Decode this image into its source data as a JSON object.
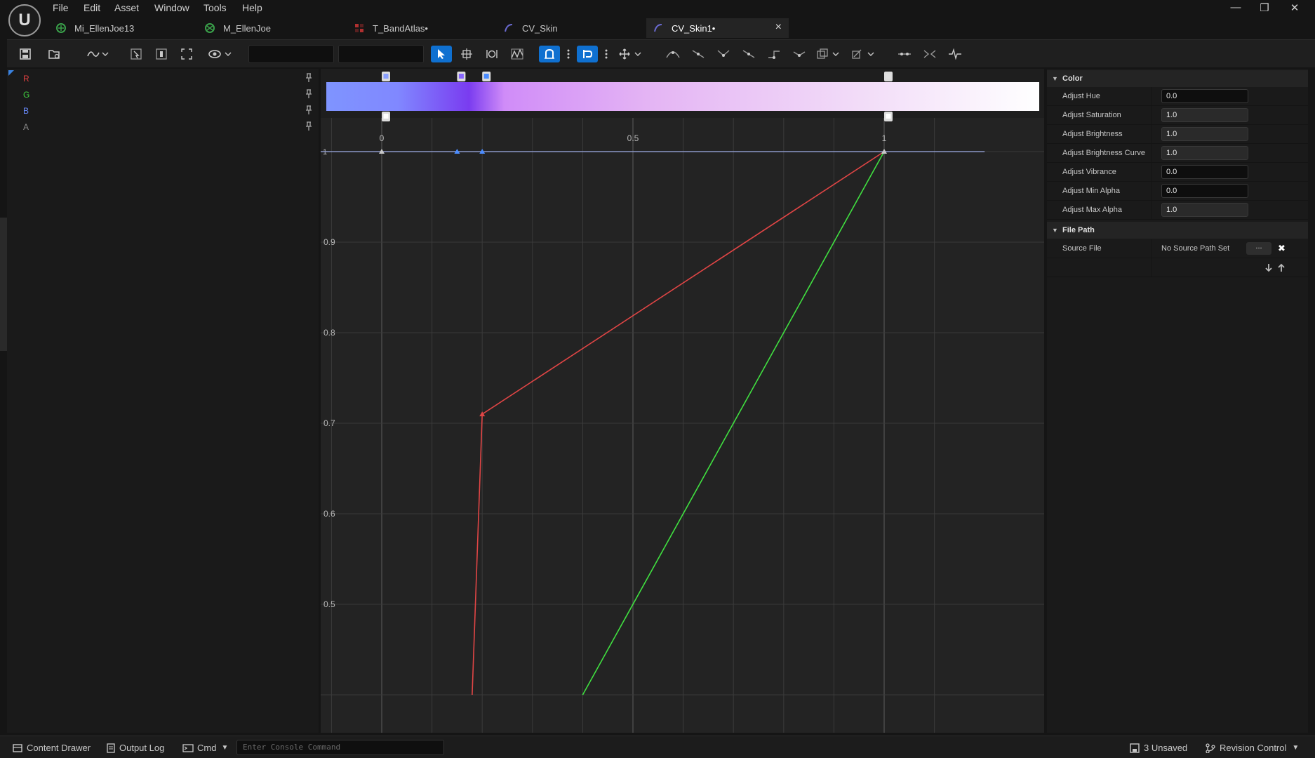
{
  "app": {
    "logo_glyph": "U"
  },
  "menu": [
    "File",
    "Edit",
    "Asset",
    "Window",
    "Tools",
    "Help"
  ],
  "window_controls": {
    "minimize": "—",
    "restore": "❐",
    "close": "✕"
  },
  "tabs": [
    {
      "label": "Mi_EllenJoe13",
      "icon": "material-instance-icon",
      "color": "#3aa04a"
    },
    {
      "label": "M_EllenJoe",
      "icon": "material-icon",
      "color": "#3aa04a"
    },
    {
      "label": "T_BandAtlas•",
      "icon": "texture-icon",
      "color": "#b03030"
    },
    {
      "label": "CV_Skin",
      "icon": "curve-icon",
      "color": "#6a6ad0"
    },
    {
      "label": "CV_Skin1•",
      "icon": "curve-icon",
      "color": "#6a6ad0",
      "active": true,
      "close": "×"
    }
  ],
  "channels": [
    {
      "label": "R",
      "color": "#e04040"
    },
    {
      "label": "G",
      "color": "#40d040"
    },
    {
      "label": "B",
      "color": "#6a8cff"
    },
    {
      "label": "A",
      "color": "#8a8a8a"
    }
  ],
  "chart_data": {
    "type": "line",
    "x_ticks": [
      "0",
      "0.5",
      "1"
    ],
    "y_ticks": [
      "0.9",
      "0.8",
      "0.7",
      "0.6",
      "0.5"
    ],
    "y_top_tick": "1",
    "view": {
      "x_min": -0.1,
      "x_max": 1.1,
      "y_min": 0.49,
      "y_max": 1.01
    },
    "series": [
      {
        "name": "R",
        "color": "#e04545",
        "points": [
          [
            0.18,
            0.4
          ],
          [
            0.2,
            0.71
          ],
          [
            1.0,
            1.0
          ]
        ]
      },
      {
        "name": "G",
        "color": "#40e040",
        "points": [
          [
            0.4,
            0.4
          ],
          [
            1.0,
            1.0
          ]
        ]
      },
      {
        "name": "B",
        "color": "#8b98c8",
        "points": [
          [
            -0.2,
            1.0
          ],
          [
            1.2,
            1.0
          ]
        ]
      }
    ],
    "keys": [
      {
        "x": 0.0,
        "y": 1.0,
        "color": "#c8c8c8"
      },
      {
        "x": 0.15,
        "y": 1.0,
        "color": "#4a8cff"
      },
      {
        "x": 0.2,
        "y": 1.0,
        "color": "#4a8cff"
      },
      {
        "x": 1.0,
        "y": 1.0,
        "color": "#c8c8c8"
      },
      {
        "x": 0.2,
        "y": 0.71,
        "color": "#e04545"
      }
    ],
    "gradient": {
      "stops": [
        {
          "pos": 0.0,
          "color": "#7f94ff"
        },
        {
          "pos": 0.1,
          "color": "#8088ff"
        },
        {
          "pos": 0.2,
          "color": "#7a3cf0"
        },
        {
          "pos": 0.25,
          "color": "#d08cf8"
        },
        {
          "pos": 0.45,
          "color": "#e4b4f4"
        },
        {
          "pos": 0.75,
          "color": "#f2dcf8"
        },
        {
          "pos": 1.0,
          "color": "#ffffff"
        }
      ],
      "top_handles": [
        {
          "x": 0.0,
          "color": "#8aa0ff"
        },
        {
          "x": 0.15,
          "color": "#8866ff"
        },
        {
          "x": 0.2,
          "color": "#4a8cff"
        },
        {
          "x": 1.0,
          "color": "#e0e0e0"
        }
      ],
      "bottom_handles": [
        {
          "x": 0.0,
          "color": "#ffffff"
        },
        {
          "x": 1.0,
          "color": "#ffffff"
        }
      ]
    }
  },
  "details": {
    "color_category": "Color",
    "properties": [
      {
        "label": "Adjust Hue",
        "value": "0.0"
      },
      {
        "label": "Adjust Saturation",
        "value": "1.0"
      },
      {
        "label": "Adjust Brightness",
        "value": "1.0"
      },
      {
        "label": "Adjust Brightness Curve",
        "value": "1.0"
      },
      {
        "label": "Adjust Vibrance",
        "value": "0.0"
      },
      {
        "label": "Adjust Min Alpha",
        "value": "0.0"
      },
      {
        "label": "Adjust Max Alpha",
        "value": "1.0"
      }
    ],
    "file_category": "File Path",
    "source_file_label": "Source File",
    "source_file_value": "No Source Path Set",
    "browse_label": "...",
    "clear_glyph": "✖"
  },
  "statusbar": {
    "content_drawer": "Content Drawer",
    "output_log": "Output Log",
    "cmd": "Cmd",
    "console_placeholder": "Enter Console Command",
    "unsaved": "3 Unsaved",
    "revision_control": "Revision Control"
  }
}
